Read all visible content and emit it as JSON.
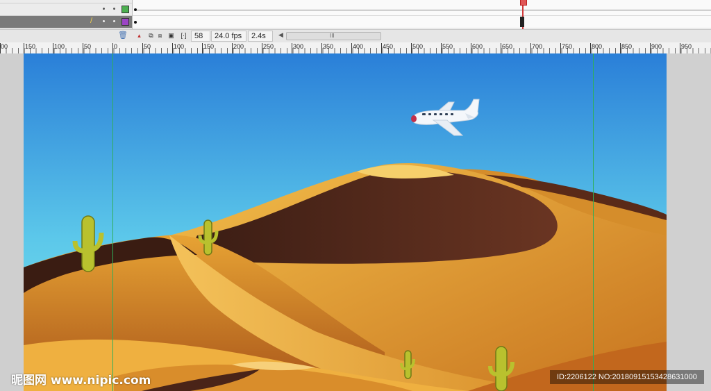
{
  "timeline": {
    "current_frame": "58",
    "frame_rate": "24.0 fps",
    "elapsed_time": "2.4s",
    "layers": [
      {
        "color": "#4caf50",
        "state": "normal"
      },
      {
        "color": "#9c45c5",
        "state": "selected"
      }
    ],
    "scrollbar_grip": "III"
  },
  "ruler": {
    "labels": [
      "00",
      "150",
      "100",
      "50",
      "0",
      "50",
      "100",
      "150",
      "200",
      "250",
      "300",
      "350",
      "400",
      "450",
      "500",
      "550",
      "600",
      "650",
      "700",
      "750",
      "800",
      "850",
      "900",
      "950"
    ]
  },
  "stage": {
    "scene": "desert-with-airplane",
    "colors": {
      "sky_top": "#2a7fd8",
      "sky_bottom": "#6de1ee",
      "sand_light": "#f0b43c",
      "sand_dark": "#b86a1a",
      "dune_shadow": "#4a2418",
      "guide_line": "#2fae5a"
    }
  },
  "watermarks": {
    "left": "昵图网 www.nipic.com",
    "right": "ID:2206122 NO:20180915153428631000"
  }
}
